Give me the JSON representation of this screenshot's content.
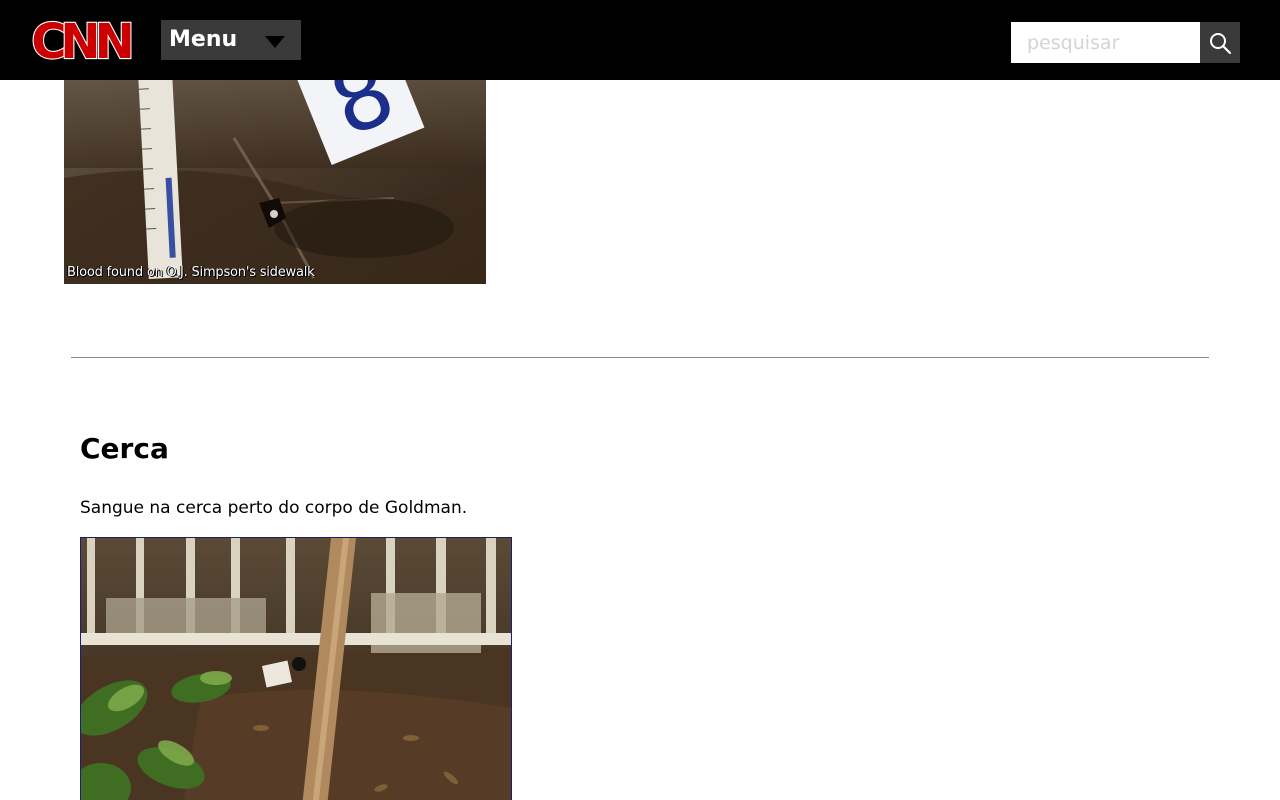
{
  "header": {
    "logo_text": "CNN",
    "menu_label": "Menu",
    "search": {
      "placeholder": "pesquisar",
      "value": ""
    },
    "icons": {
      "menu": "caret-down-icon",
      "search": "magnifier-icon"
    },
    "colors": {
      "bar": "#000000",
      "logo": "#cc0000",
      "button": "#3a3a3a"
    }
  },
  "photo1": {
    "caption": "Blood found on O.J. Simpson's sidewalk",
    "evidence_marker": "8"
  },
  "section": {
    "title": "Cerca",
    "text": "Sangue na cerca perto do corpo de Goldman."
  }
}
